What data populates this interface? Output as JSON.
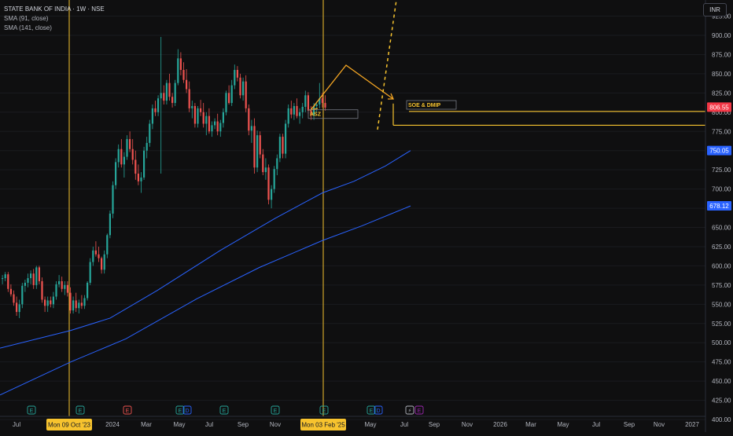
{
  "legend": {
    "title": "STATE BANK OF INDIA · 1W · NSE",
    "sma1": "SMA (91, close)",
    "sma2": "SMA (141, close)"
  },
  "currency_button": "INR",
  "colors": {
    "background": "#0f0f10",
    "up": "#26a69a",
    "down": "#ef5350",
    "sma": "#2962ff",
    "annotation": "#f7c32e",
    "price_label": "#f23645",
    "sma_label": "#2962ff"
  },
  "chart_data": {
    "type": "candlestick",
    "symbol": "STATE BANK OF INDIA",
    "interval": "1W",
    "exchange": "NSE",
    "ylim": [
      398,
      946
    ],
    "y_ticks": [
      400,
      425,
      450,
      475,
      500,
      525,
      550,
      575,
      600,
      625,
      650,
      675,
      700,
      725,
      750,
      775,
      800,
      825,
      850,
      875,
      900,
      925
    ],
    "x_ticks": [
      "Jul",
      "2024",
      "Mar",
      "May",
      "Jul",
      "Sep",
      "Nov",
      "May",
      "Jul",
      "Sep",
      "Nov",
      "2026",
      "Mar",
      "May",
      "Jul",
      "Sep",
      "Nov",
      "2027"
    ],
    "vertical_markers": [
      {
        "label": "Mon 09 Oct '23"
      },
      {
        "label": "Mon 03 Feb '25"
      }
    ],
    "price_labels": [
      {
        "value": "806.55",
        "price": 806.55
      },
      {
        "value": "750.05",
        "price": 750.05
      },
      {
        "value": "678.12",
        "price": 678.12
      }
    ],
    "annotations": [
      {
        "text": "ASZ",
        "price": 797
      },
      {
        "text": "SOE & DMIP",
        "price": 810
      }
    ],
    "horizontal_lines": [
      801,
      783
    ],
    "sma_series": [
      {
        "name": "SMA (91, close)",
        "points": [
          [
            0,
            493
          ],
          [
            90,
            516
          ],
          [
            140,
            532
          ],
          [
            200,
            568
          ],
          [
            280,
            620
          ],
          [
            350,
            662
          ],
          [
            410,
            695
          ],
          [
            450,
            710
          ],
          [
            490,
            730
          ],
          [
            522,
            750
          ]
        ]
      },
      {
        "name": "SMA (141, close)",
        "points": [
          [
            0,
            432
          ],
          [
            90,
            475
          ],
          [
            160,
            505
          ],
          [
            250,
            557
          ],
          [
            330,
            598
          ],
          [
            410,
            633
          ],
          [
            460,
            652
          ],
          [
            522,
            678
          ]
        ]
      }
    ],
    "candles": [
      [
        583,
        588,
        576,
        584
      ],
      [
        584,
        592,
        580,
        589
      ],
      [
        589,
        592,
        566,
        570
      ],
      [
        570,
        576,
        560,
        563
      ],
      [
        563,
        568,
        548,
        552
      ],
      [
        552,
        560,
        535,
        540
      ],
      [
        540,
        556,
        532,
        550
      ],
      [
        550,
        578,
        545,
        574
      ],
      [
        574,
        582,
        566,
        578
      ],
      [
        578,
        590,
        572,
        584
      ],
      [
        584,
        594,
        576,
        590
      ],
      [
        590,
        596,
        570,
        575
      ],
      [
        575,
        600,
        570,
        598
      ],
      [
        598,
        600,
        576,
        580
      ],
      [
        580,
        585,
        552,
        556
      ],
      [
        556,
        560,
        540,
        548
      ],
      [
        548,
        560,
        540,
        555
      ],
      [
        555,
        560,
        546,
        550
      ],
      [
        550,
        566,
        545,
        560
      ],
      [
        560,
        580,
        556,
        576
      ],
      [
        576,
        588,
        572,
        580
      ],
      [
        580,
        586,
        566,
        570
      ],
      [
        570,
        580,
        562,
        575
      ],
      [
        575,
        580,
        560,
        565
      ],
      [
        565,
        572,
        538,
        542
      ],
      [
        542,
        560,
        538,
        555
      ],
      [
        555,
        565,
        540,
        545
      ],
      [
        545,
        556,
        538,
        552
      ],
      [
        552,
        562,
        544,
        548
      ],
      [
        548,
        562,
        544,
        558
      ],
      [
        558,
        580,
        555,
        578
      ],
      [
        578,
        610,
        575,
        605
      ],
      [
        605,
        625,
        600,
        620
      ],
      [
        620,
        632,
        612,
        615
      ],
      [
        615,
        625,
        605,
        610
      ],
      [
        610,
        612,
        590,
        595
      ],
      [
        595,
        620,
        590,
        615
      ],
      [
        615,
        642,
        610,
        640
      ],
      [
        640,
        672,
        636,
        668
      ],
      [
        668,
        710,
        662,
        705
      ],
      [
        705,
        740,
        700,
        735
      ],
      [
        735,
        758,
        728,
        752
      ],
      [
        752,
        765,
        728,
        732
      ],
      [
        732,
        748,
        715,
        742
      ],
      [
        742,
        770,
        738,
        765
      ],
      [
        765,
        775,
        748,
        752
      ],
      [
        752,
        765,
        732,
        738
      ],
      [
        738,
        750,
        712,
        720
      ],
      [
        720,
        732,
        705,
        710
      ],
      [
        710,
        722,
        695,
        715
      ],
      [
        715,
        755,
        712,
        750
      ],
      [
        750,
        768,
        740,
        760
      ],
      [
        760,
        790,
        755,
        785
      ],
      [
        785,
        810,
        778,
        805
      ],
      [
        805,
        815,
        795,
        800
      ],
      [
        800,
        822,
        795,
        818
      ],
      [
        818,
        898,
        720,
        825
      ],
      [
        825,
        835,
        810,
        815
      ],
      [
        815,
        842,
        810,
        838
      ],
      [
        838,
        850,
        815,
        820
      ],
      [
        820,
        825,
        806,
        812
      ],
      [
        812,
        842,
        808,
        838
      ],
      [
        838,
        882,
        835,
        870
      ],
      [
        870,
        878,
        848,
        855
      ],
      [
        855,
        865,
        838,
        842
      ],
      [
        842,
        856,
        825,
        830
      ],
      [
        830,
        840,
        800,
        805
      ],
      [
        805,
        815,
        792,
        808
      ],
      [
        808,
        812,
        780,
        785
      ],
      [
        785,
        808,
        780,
        805
      ],
      [
        805,
        816,
        795,
        800
      ],
      [
        800,
        812,
        780,
        785
      ],
      [
        785,
        800,
        770,
        795
      ],
      [
        795,
        805,
        772,
        775
      ],
      [
        775,
        788,
        768,
        783
      ],
      [
        783,
        792,
        778,
        788
      ],
      [
        788,
        798,
        770,
        775
      ],
      [
        775,
        790,
        768,
        786
      ],
      [
        786,
        805,
        780,
        800
      ],
      [
        800,
        828,
        796,
        825
      ],
      [
        825,
        835,
        810,
        812
      ],
      [
        812,
        842,
        808,
        835
      ],
      [
        835,
        862,
        830,
        855
      ],
      [
        855,
        860,
        840,
        845
      ],
      [
        845,
        850,
        818,
        822
      ],
      [
        822,
        845,
        815,
        840
      ],
      [
        840,
        848,
        800,
        805
      ],
      [
        805,
        810,
        770,
        776
      ],
      [
        776,
        790,
        760,
        782
      ],
      [
        782,
        792,
        720,
        728
      ],
      [
        728,
        776,
        722,
        770
      ],
      [
        770,
        775,
        740,
        745
      ],
      [
        745,
        752,
        718,
        722
      ],
      [
        722,
        740,
        712,
        728
      ],
      [
        728,
        732,
        680,
        686
      ],
      [
        686,
        705,
        675,
        700
      ],
      [
        700,
        730,
        695,
        726
      ],
      [
        726,
        745,
        718,
        740
      ],
      [
        740,
        772,
        735,
        768
      ],
      [
        768,
        772,
        740,
        746
      ],
      [
        746,
        790,
        740,
        785
      ],
      [
        785,
        810,
        780,
        805
      ],
      [
        805,
        815,
        792,
        797
      ],
      [
        797,
        812,
        790,
        808
      ],
      [
        808,
        818,
        792,
        795
      ],
      [
        795,
        805,
        785,
        800
      ],
      [
        800,
        812,
        792,
        807
      ],
      [
        807,
        828,
        800,
        822
      ],
      [
        822,
        826,
        798,
        802
      ],
      [
        802,
        808,
        790,
        796
      ],
      [
        796,
        812,
        790,
        808
      ],
      [
        808,
        814,
        800,
        810
      ],
      [
        810,
        838,
        805,
        818
      ],
      [
        818,
        825,
        806,
        812
      ],
      [
        812,
        822,
        802,
        806
      ]
    ],
    "events": [
      {
        "label": "E"
      },
      {
        "label": "E"
      },
      {
        "label": "E"
      },
      {
        "label": "E"
      },
      {
        "label": "D"
      },
      {
        "label": "E"
      },
      {
        "label": "E"
      },
      {
        "label": "E"
      },
      {
        "label": "E"
      },
      {
        "label": "D"
      },
      {
        "label": "⚡"
      },
      {
        "label": "E"
      }
    ]
  }
}
